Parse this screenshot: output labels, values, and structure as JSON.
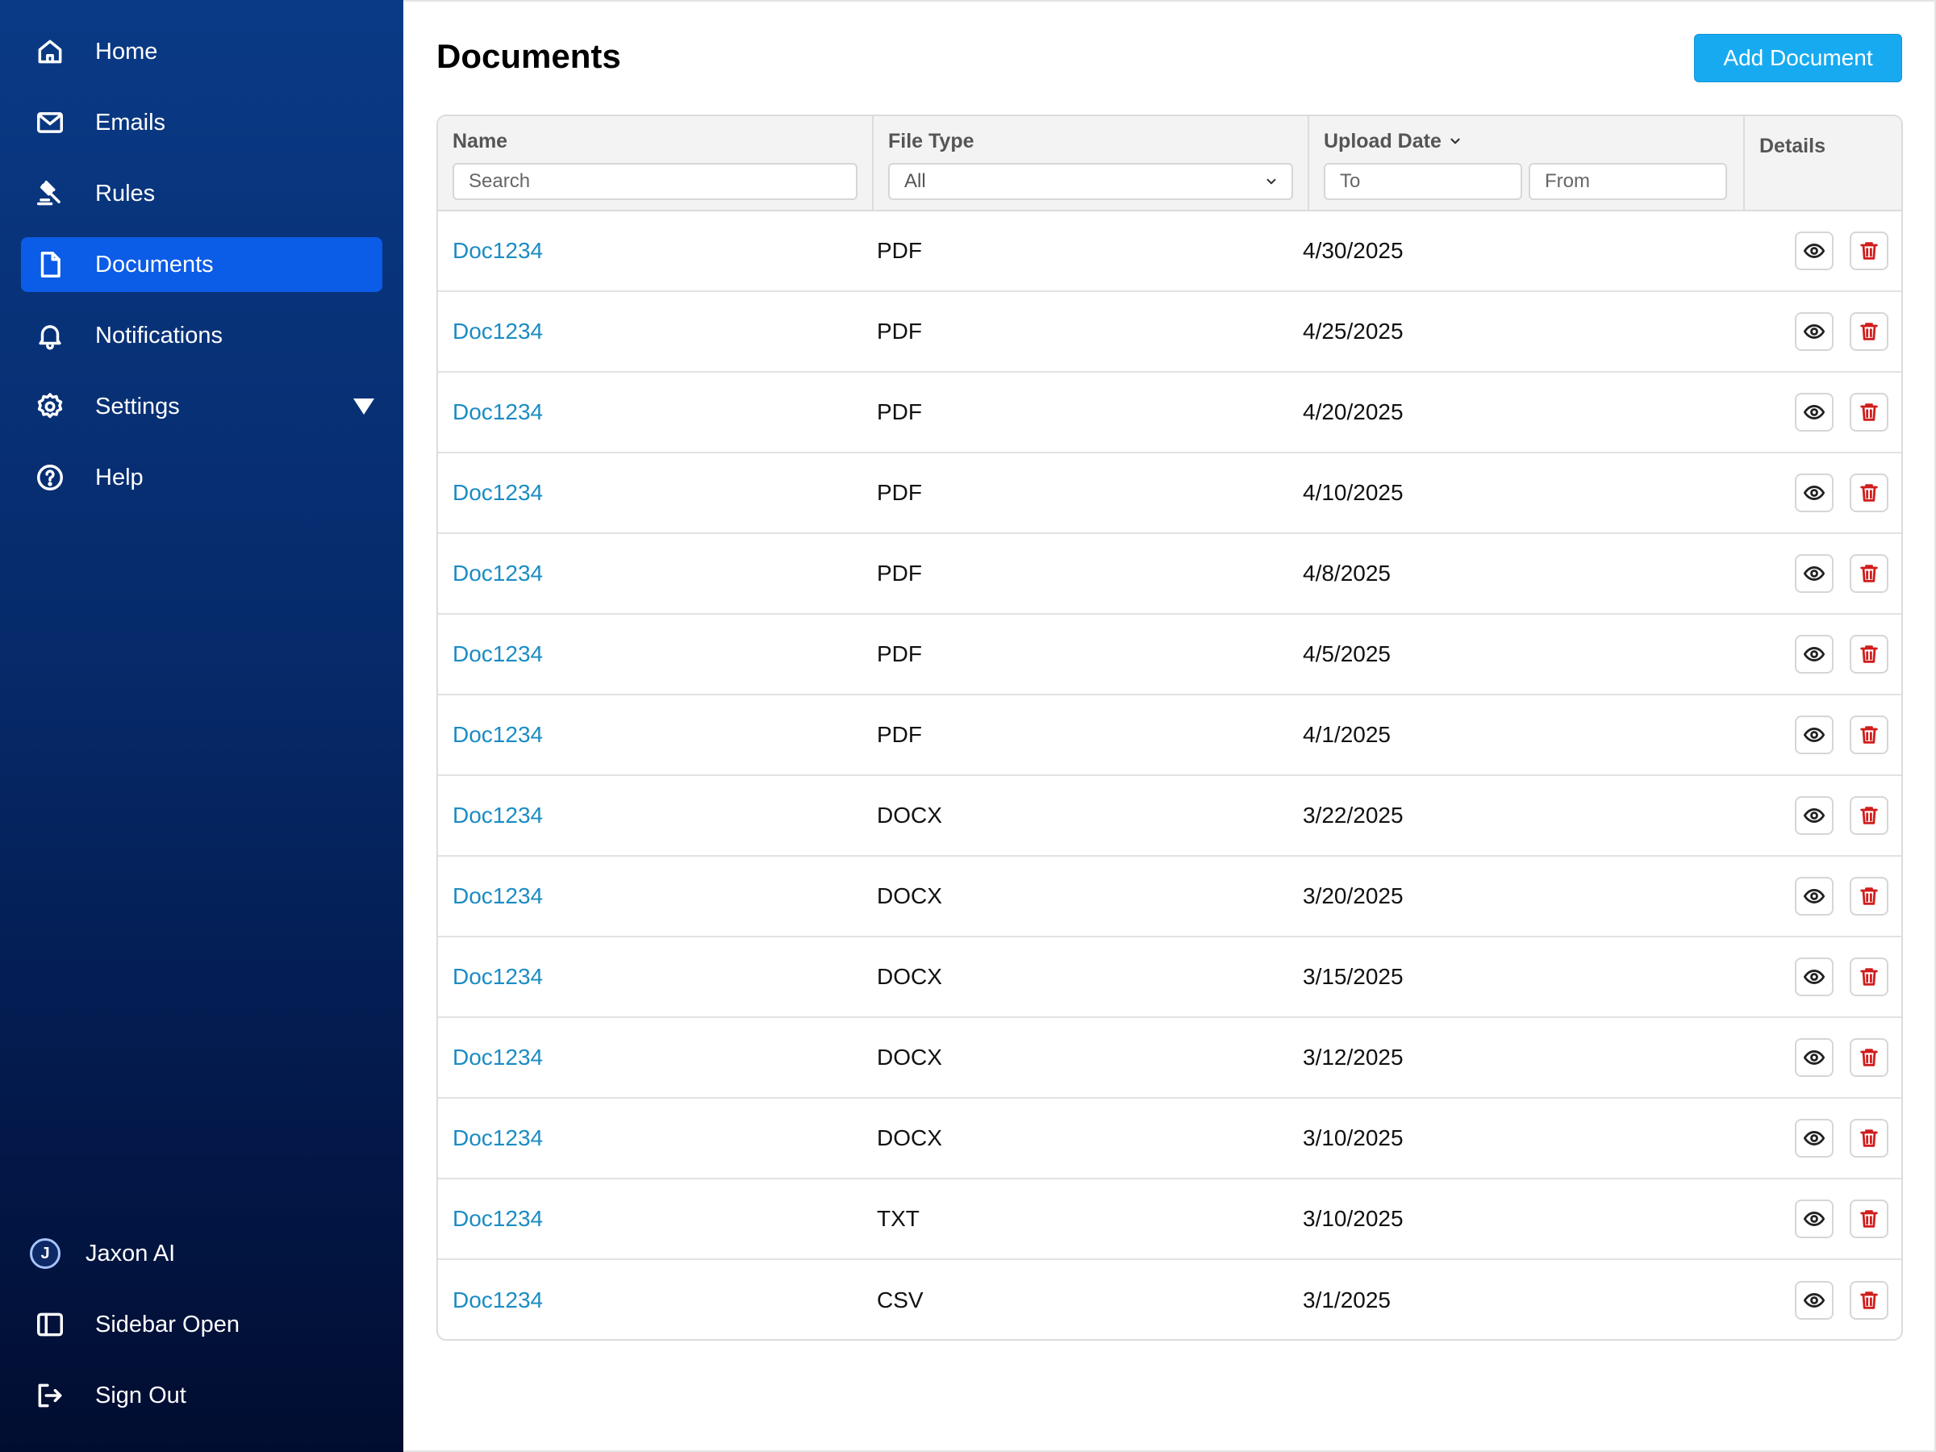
{
  "sidebar": {
    "items": [
      {
        "label": "Home",
        "icon": "home-icon"
      },
      {
        "label": "Emails",
        "icon": "mail-icon"
      },
      {
        "label": "Rules",
        "icon": "gavel-icon"
      },
      {
        "label": "Documents",
        "icon": "document-icon",
        "active": true
      },
      {
        "label": "Notifications",
        "icon": "bell-icon"
      },
      {
        "label": "Settings",
        "icon": "gear-icon"
      },
      {
        "label": "Help",
        "icon": "help-icon"
      }
    ],
    "bottom": {
      "user": {
        "label": "Jaxon AI",
        "avatar_initial": "J"
      },
      "sidebar_toggle": "Sidebar Open",
      "sign_out": "Sign Out"
    }
  },
  "header": {
    "title": "Documents",
    "add_button": "Add Document"
  },
  "table": {
    "columns": {
      "name": "Name",
      "file_type": "File Type",
      "upload_date": "Upload Date",
      "details": "Details"
    },
    "filters": {
      "name_placeholder": "Search",
      "file_type_value": "All",
      "date_to_placeholder": "To",
      "date_from_placeholder": "From"
    },
    "rows": [
      {
        "name": "Doc1234",
        "type": "PDF",
        "date": "4/30/2025"
      },
      {
        "name": "Doc1234",
        "type": "PDF",
        "date": "4/25/2025"
      },
      {
        "name": "Doc1234",
        "type": "PDF",
        "date": "4/20/2025"
      },
      {
        "name": "Doc1234",
        "type": "PDF",
        "date": "4/10/2025"
      },
      {
        "name": "Doc1234",
        "type": "PDF",
        "date": "4/8/2025"
      },
      {
        "name": "Doc1234",
        "type": "PDF",
        "date": "4/5/2025"
      },
      {
        "name": "Doc1234",
        "type": "PDF",
        "date": "4/1/2025"
      },
      {
        "name": "Doc1234",
        "type": "DOCX",
        "date": "3/22/2025"
      },
      {
        "name": "Doc1234",
        "type": "DOCX",
        "date": "3/20/2025"
      },
      {
        "name": "Doc1234",
        "type": "DOCX",
        "date": "3/15/2025"
      },
      {
        "name": "Doc1234",
        "type": "DOCX",
        "date": "3/12/2025"
      },
      {
        "name": "Doc1234",
        "type": "DOCX",
        "date": "3/10/2025"
      },
      {
        "name": "Doc1234",
        "type": "TXT",
        "date": "3/10/2025"
      },
      {
        "name": "Doc1234",
        "type": "CSV",
        "date": "3/1/2025"
      }
    ]
  },
  "colors": {
    "sidebar_top": "#0a3a86",
    "sidebar_bottom": "#010d30",
    "active_item": "#0b5ce6",
    "accent": "#18aaf0",
    "link": "#1b8cc4",
    "delete": "#d11d1d"
  }
}
